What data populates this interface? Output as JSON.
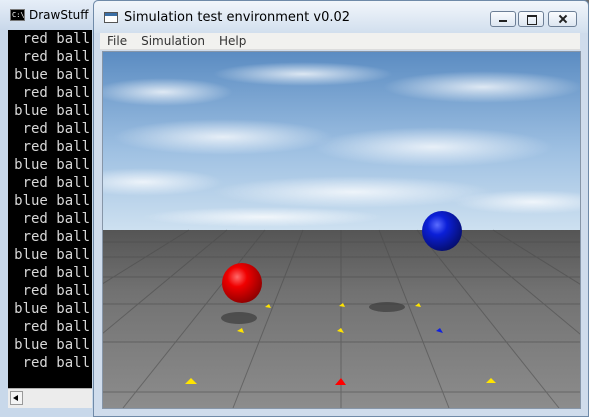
{
  "console": {
    "title": "DrawStuff",
    "lines": [
      "red ball",
      "red ball",
      "blue ball",
      "red ball",
      "blue ball",
      "red ball",
      "red ball",
      "blue ball",
      "red ball",
      "blue ball",
      "red ball",
      "red ball",
      "blue ball",
      "red ball",
      "red ball",
      "blue ball",
      "red ball",
      "blue ball",
      "red ball"
    ]
  },
  "window": {
    "title": "Simulation test environment v0.02",
    "menu": [
      "File",
      "Simulation",
      "Help"
    ]
  },
  "scene": {
    "balls": [
      {
        "name": "red-ball",
        "color": "#e00000"
      },
      {
        "name": "blue-ball",
        "color": "#0a1ed0"
      }
    ],
    "markers": [
      {
        "color": "#ffe400"
      },
      {
        "color": "#ffe400"
      },
      {
        "color": "#ffe400"
      },
      {
        "color": "#ffe400"
      },
      {
        "color": "#ffe400"
      },
      {
        "color": "#1020e0"
      },
      {
        "color": "#ffe400"
      },
      {
        "color": "#ff0000"
      },
      {
        "color": "#ffe400"
      }
    ],
    "colors": {
      "sky_top": "#5d8ec4",
      "sky_horizon": "#c8dcef",
      "ground": "#6e6e6e"
    }
  }
}
